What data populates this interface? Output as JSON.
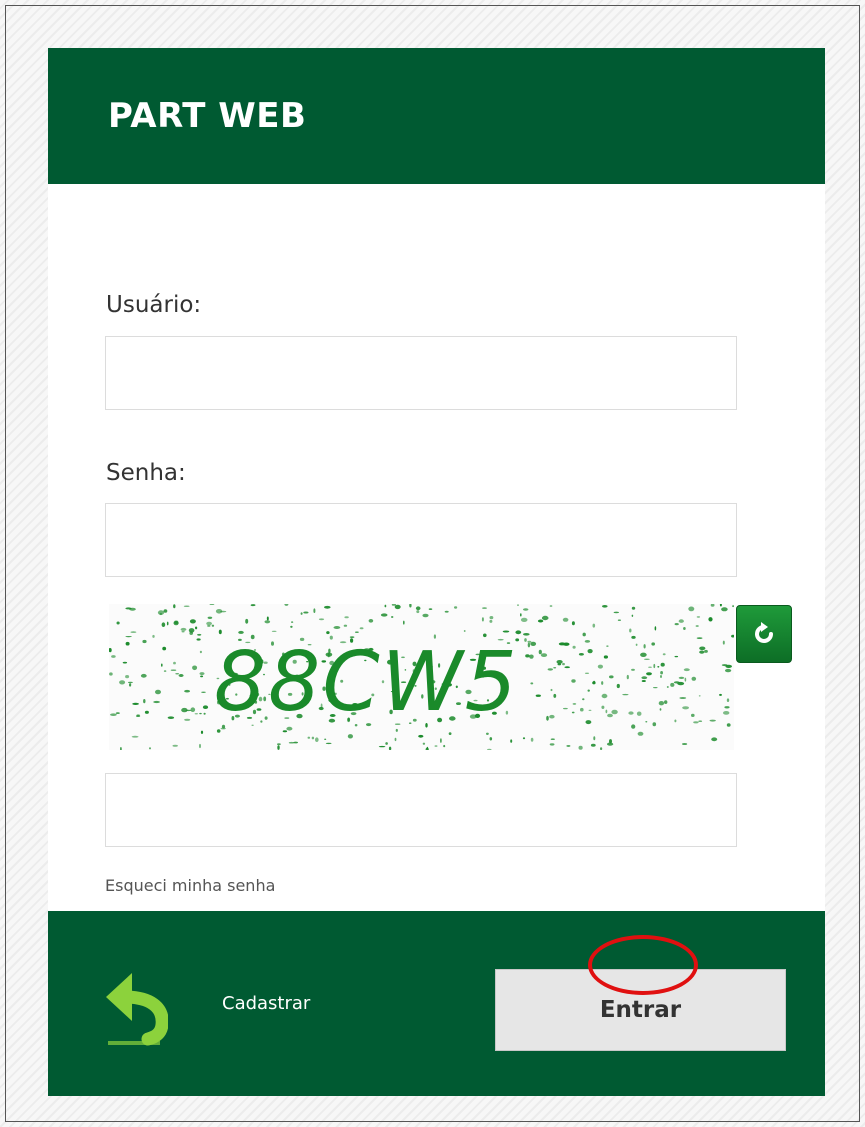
{
  "header": {
    "title": "PART WEB"
  },
  "form": {
    "username_label": "Usuário:",
    "username_value": "",
    "password_label": "Senha:",
    "password_value": "",
    "captcha_text": "88CW5",
    "captcha_input_value": "",
    "forgot_password_link": "Esqueci minha senha"
  },
  "footer": {
    "back_icon": "back-arrow-icon",
    "register_link": "Cadastrar",
    "enter_button": "Entrar"
  },
  "icons": {
    "refresh": "refresh-icon"
  },
  "colors": {
    "brand_green": "#005a32",
    "captcha_green": "#1a8a2a",
    "highlight_red": "#e01010"
  }
}
